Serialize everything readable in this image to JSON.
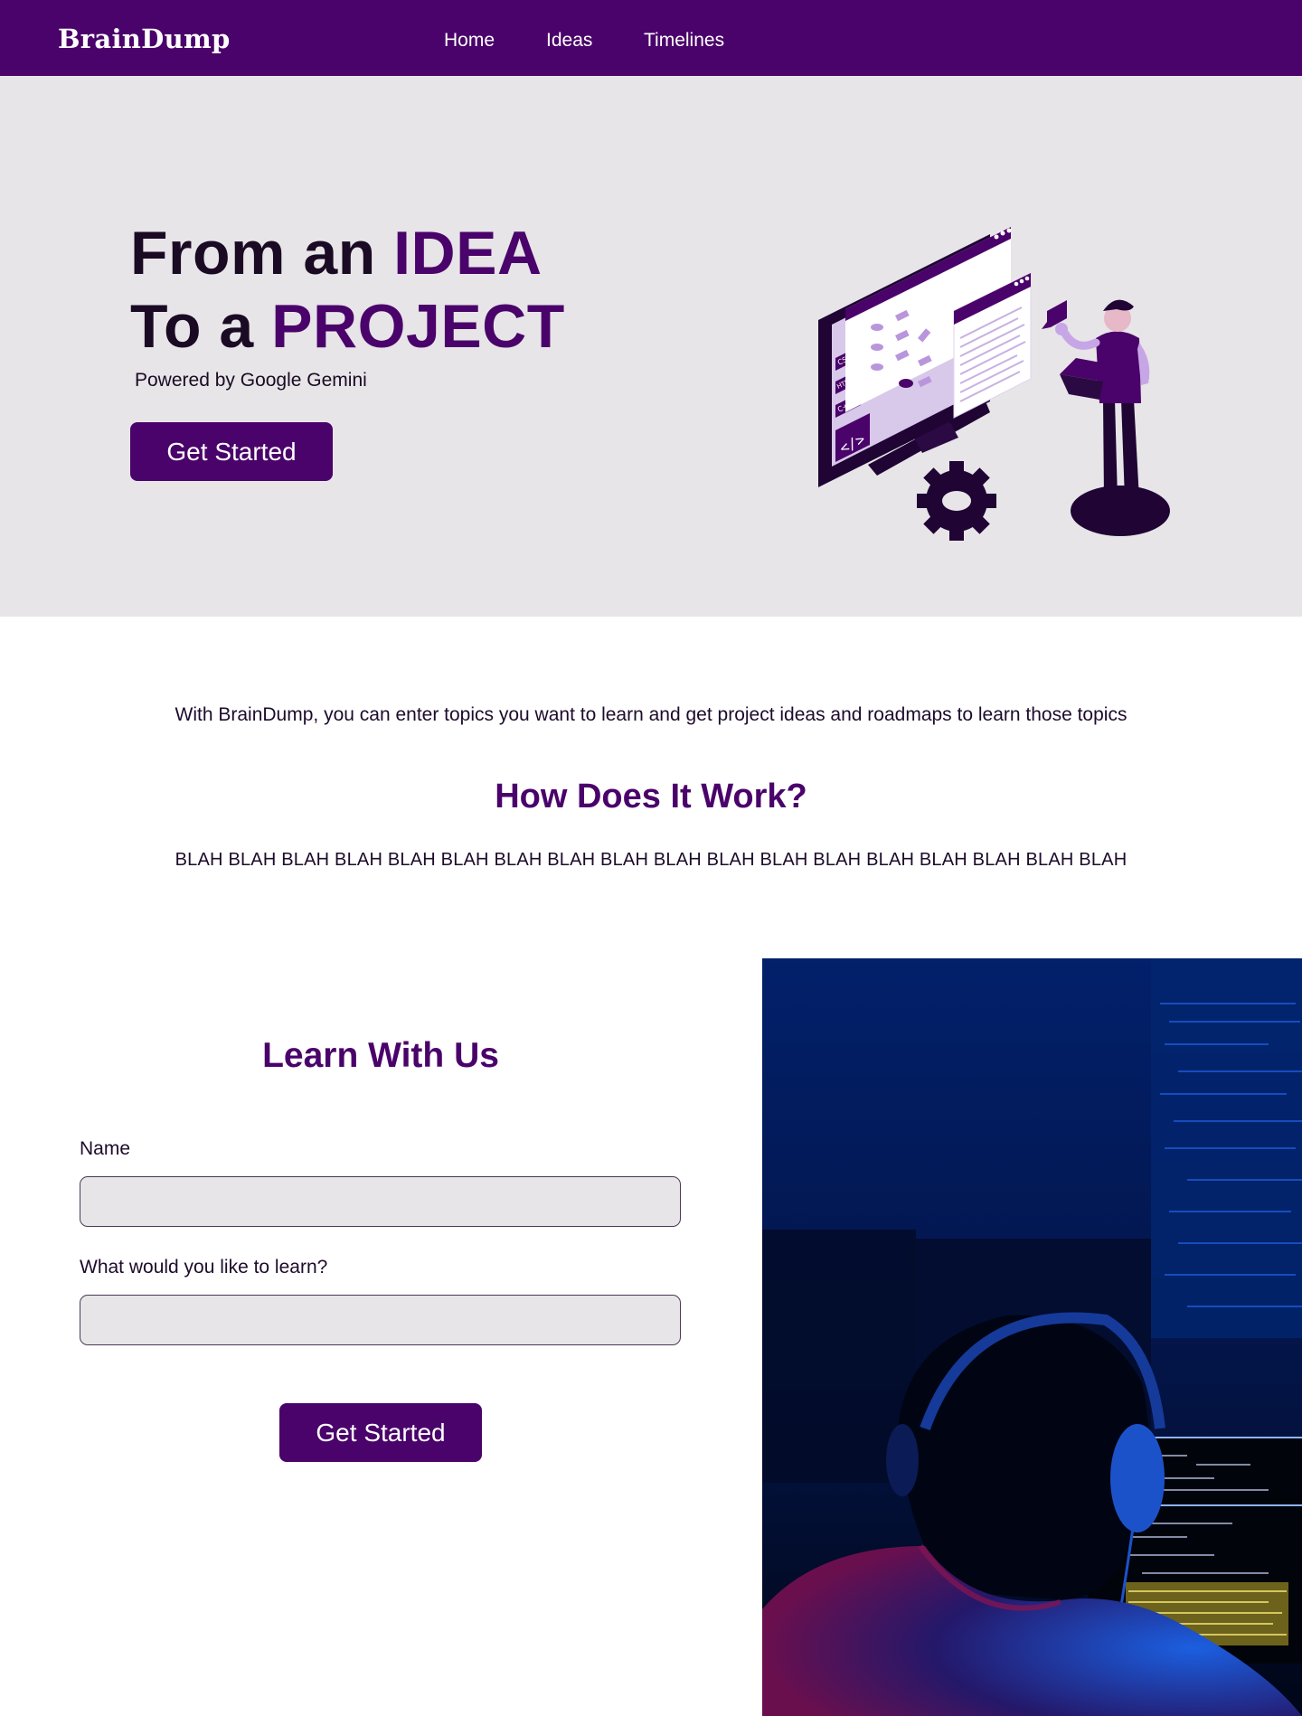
{
  "navbar": {
    "brand": "BrainDump",
    "links": [
      "Home",
      "Ideas",
      "Timelines"
    ]
  },
  "hero": {
    "title_line1_prefix": "From an ",
    "title_line1_accent": "IDEA",
    "title_line2_prefix": "To a ",
    "title_line2_accent": "PROJECT",
    "subtitle": "Powered by Google Gemini",
    "button_label": "Get Started",
    "illustration": {
      "screen_tags": [
        "CSS",
        "HTML",
        "C++"
      ],
      "icons": [
        "code-icon",
        "gear-icon",
        "chat-bubble-icon"
      ]
    }
  },
  "intro": {
    "text": "With BrainDump, you can enter topics you want to learn and get project ideas and roadmaps to learn those topics"
  },
  "how": {
    "title": "How Does It Work?",
    "body": "BLAH BLAH BLAH BLAH BLAH BLAH BLAH BLAH BLAH BLAH BLAH BLAH BLAH BLAH BLAH BLAH BLAH BLAH"
  },
  "learn": {
    "title": "Learn With Us",
    "name_label": "Name",
    "name_value": "",
    "topic_label": "What would you like to learn?",
    "topic_value": "",
    "button_label": "Get Started"
  },
  "colors": {
    "primary": "#4a036a",
    "hero_bg": "#e7e5e8",
    "text_dark": "#1a0a24",
    "white": "#ffffff"
  }
}
